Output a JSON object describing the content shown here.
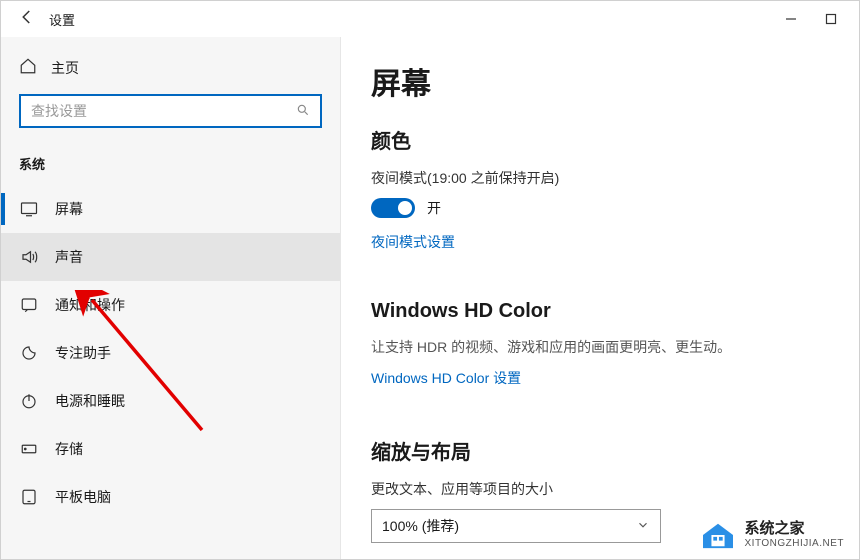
{
  "titlebar": {
    "title": "设置"
  },
  "sidebar": {
    "home_label": "主页",
    "search_placeholder": "查找设置",
    "section_title": "系统",
    "items": [
      {
        "label": "屏幕"
      },
      {
        "label": "声音"
      },
      {
        "label": "通知和操作"
      },
      {
        "label": "专注助手"
      },
      {
        "label": "电源和睡眠"
      },
      {
        "label": "存储"
      },
      {
        "label": "平板电脑"
      }
    ]
  },
  "content": {
    "page_title": "屏幕",
    "color_heading": "颜色",
    "night_mode_label": "夜间模式(19:00 之前保持开启)",
    "toggle_state": "开",
    "night_mode_link": "夜间模式设置",
    "hd_heading": "Windows HD Color",
    "hd_desc": "让支持 HDR 的视频、游戏和应用的画面更明亮、更生动。",
    "hd_link": "Windows HD Color 设置",
    "scale_heading": "缩放与布局",
    "scale_label": "更改文本、应用等项目的大小",
    "scale_value": "100% (推荐)"
  },
  "watermark": {
    "line1": "系统之家",
    "line2": "XITONGZHIJIA.NET"
  }
}
